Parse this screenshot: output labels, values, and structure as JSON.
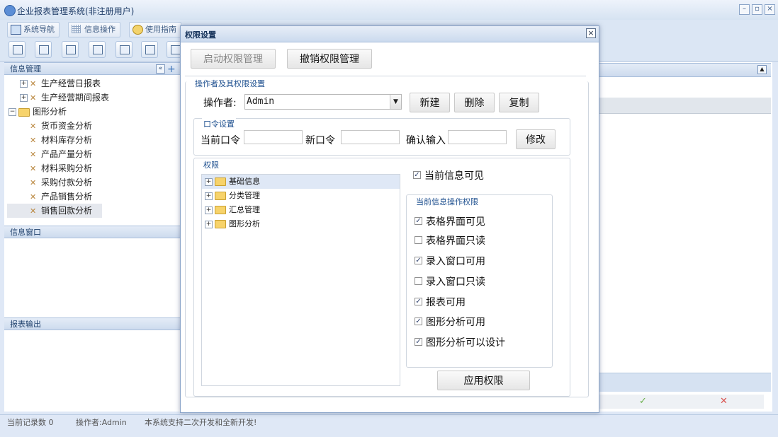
{
  "app": {
    "title": "企业报表管理系统(非注册用户)",
    "tabs": [
      "系统导航",
      "信息操作",
      "使用指南"
    ],
    "toolbar_icons": [
      "search-icon",
      "list-icon",
      "document-icon",
      "users-icon",
      "monitor-icon",
      "edit-icon",
      "printer-icon"
    ]
  },
  "left": {
    "info_header": "信息管理",
    "tree": [
      {
        "label": "生产经营日报表",
        "level": 1,
        "type": "leaf-group"
      },
      {
        "label": "生产经营期间报表",
        "level": 1,
        "type": "leaf-group"
      },
      {
        "label": "图形分析",
        "level": 0,
        "type": "folder"
      },
      {
        "label": "货币资金分析",
        "level": 2,
        "type": "leaf"
      },
      {
        "label": "材料库存分析",
        "level": 2,
        "type": "leaf"
      },
      {
        "label": "产品产量分析",
        "level": 2,
        "type": "leaf"
      },
      {
        "label": "材料采购分析",
        "level": 2,
        "type": "leaf"
      },
      {
        "label": "采购付款分析",
        "level": 2,
        "type": "leaf"
      },
      {
        "label": "产品销售分析",
        "level": 2,
        "type": "leaf"
      },
      {
        "label": "销售回款分析",
        "level": 2,
        "type": "leaf",
        "selected": true
      }
    ],
    "window_header": "信息窗口",
    "output_header": "报表输出"
  },
  "statusbar": {
    "records": "当前记录数 0",
    "operator": "操作者:Admin",
    "message": "本系统支持二次开发和全新开发!"
  },
  "dialog": {
    "title": "权限设置",
    "close": "×",
    "enable_btn": "启动权限管理",
    "revoke_btn": "撤销权限管理",
    "operator_section": "操作者及其权限设置",
    "operator_label": "操作者:",
    "operator_value": "Admin",
    "new_btn": "新建",
    "delete_btn": "删除",
    "copy_btn": "复制",
    "password_section": "口令设置",
    "current_pwd_label": "当前口令",
    "new_pwd_label": "新口令",
    "confirm_pwd_label": "确认输入",
    "modify_btn": "修改",
    "perm_section": "权限",
    "perm_tree": [
      "基础信息",
      "分类管理",
      "汇总管理",
      "图形分析"
    ],
    "visible_label": "当前信息可见",
    "visible_checked": true,
    "ops_section": "当前信息操作权限",
    "ops": [
      {
        "label": "表格界面可见",
        "checked": true
      },
      {
        "label": "表格界面只读",
        "checked": false
      },
      {
        "label": "录入窗口可用",
        "checked": true
      },
      {
        "label": "录入窗口只读",
        "checked": false
      },
      {
        "label": "报表可用",
        "checked": true
      },
      {
        "label": "图形分析可用",
        "checked": true
      },
      {
        "label": "图形分析可以设计",
        "checked": true
      }
    ],
    "apply_btn": "应用权限"
  },
  "right": {
    "check_symbol": "✓",
    "cross_symbol": "✕"
  }
}
